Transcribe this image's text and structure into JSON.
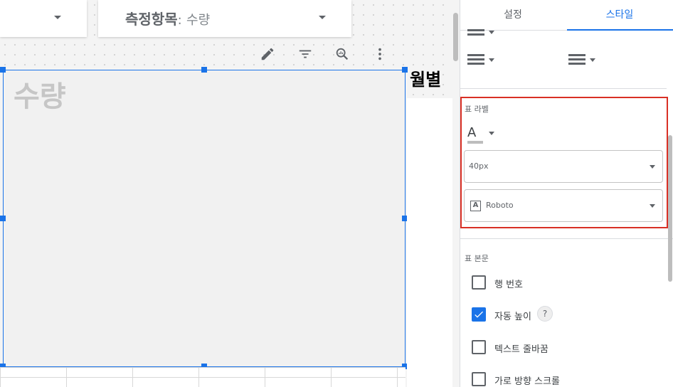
{
  "canvas": {
    "metric_control": {
      "label": "측정항목",
      "separator": ":",
      "value": "수량"
    },
    "table_label": "수량",
    "chart_title": "월별"
  },
  "panel": {
    "tabs": [
      {
        "label": "설정",
        "active": false
      },
      {
        "label": "스타일",
        "active": true
      }
    ],
    "table_label_section": {
      "title": "표 라벨",
      "font_color_glyph": "A",
      "font_size": "40px",
      "font_family_glyph": "A",
      "font_family": "Roboto"
    },
    "table_body_section": {
      "title": "표 본문",
      "options": [
        {
          "label": "행 번호",
          "checked": false
        },
        {
          "label": "자동 높이",
          "checked": true,
          "help": "?"
        },
        {
          "label": "텍스트 줄바꿈",
          "checked": false
        },
        {
          "label": "가로 방향 스크롤",
          "checked": false
        }
      ]
    }
  },
  "colors": {
    "accent": "#1a73e8",
    "highlight": "#d93025",
    "table_label": "#c6c6c6"
  },
  "icons": [
    "edit-icon",
    "filter-icon",
    "explore-icon",
    "more-vert-icon",
    "dropdown-arrow-icon",
    "check-icon",
    "help-icon",
    "font-icon",
    "border-style-icon"
  ]
}
